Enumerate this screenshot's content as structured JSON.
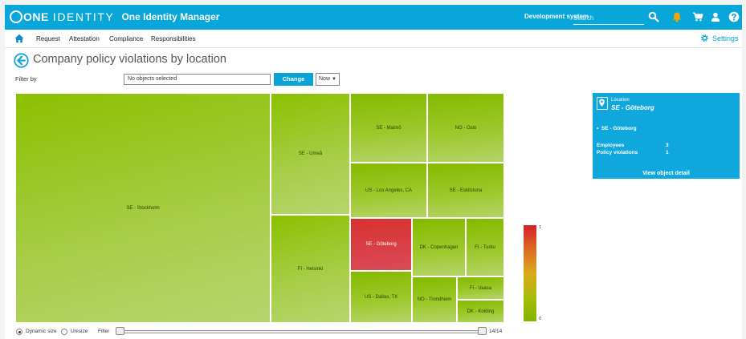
{
  "header": {
    "logo_one": "ONE",
    "logo_identity": "IDENTITY",
    "app_name": "One Identity Manager",
    "system_label": "Development system",
    "search_placeholder": "Search",
    "icons": [
      "search-icon",
      "bell-icon",
      "cart-icon",
      "user-icon",
      "help-icon"
    ],
    "brand_color": "#09a6d9",
    "bell_color": "#f5a400"
  },
  "nav": {
    "items": [
      "Request",
      "Attestation",
      "Compliance",
      "Responsibilities"
    ],
    "settings_label": "Settings"
  },
  "page": {
    "title": "Company policy violations by location"
  },
  "filter": {
    "label": "Filter by",
    "value": "No objects selected",
    "change_label": "Change",
    "period": "Now"
  },
  "treemap": {
    "tiles": [
      {
        "name": "SE - Stockholm",
        "color": "green"
      },
      {
        "name": "SE - Umeå",
        "color": "green"
      },
      {
        "name": "FI - Helsinki",
        "color": "green"
      },
      {
        "name": "SE - Malmö",
        "color": "green"
      },
      {
        "name": "NO - Oslo",
        "color": "green"
      },
      {
        "name": "US - Los Angeles, CA",
        "color": "green"
      },
      {
        "name": "SE - Eskilstuna",
        "color": "green"
      },
      {
        "name": "SE - Göteborg",
        "color": "red"
      },
      {
        "name": "DK - Copenhagen",
        "color": "green"
      },
      {
        "name": "FI - Turku",
        "color": "green"
      },
      {
        "name": "US - Dallas, TX",
        "color": "green"
      },
      {
        "name": "NO - Trondheim",
        "color": "green"
      },
      {
        "name": "FI - Vaasa",
        "color": "green"
      },
      {
        "name": "DK - Kolding",
        "color": "green"
      }
    ]
  },
  "legend": {
    "max": "1",
    "min": "0"
  },
  "controls": {
    "dynamic_size": "Dynamic size",
    "unisize": "Unisize",
    "filter_label": "Filter",
    "count": "14/14"
  },
  "detail": {
    "location_label": "Location",
    "location_value": "SE - Göteborg",
    "bullet": "SE - Göteborg",
    "rows": [
      {
        "label": "Employees",
        "value": "3"
      },
      {
        "label": "Policy violations",
        "value": "1"
      }
    ],
    "link_label": "View object detail"
  }
}
